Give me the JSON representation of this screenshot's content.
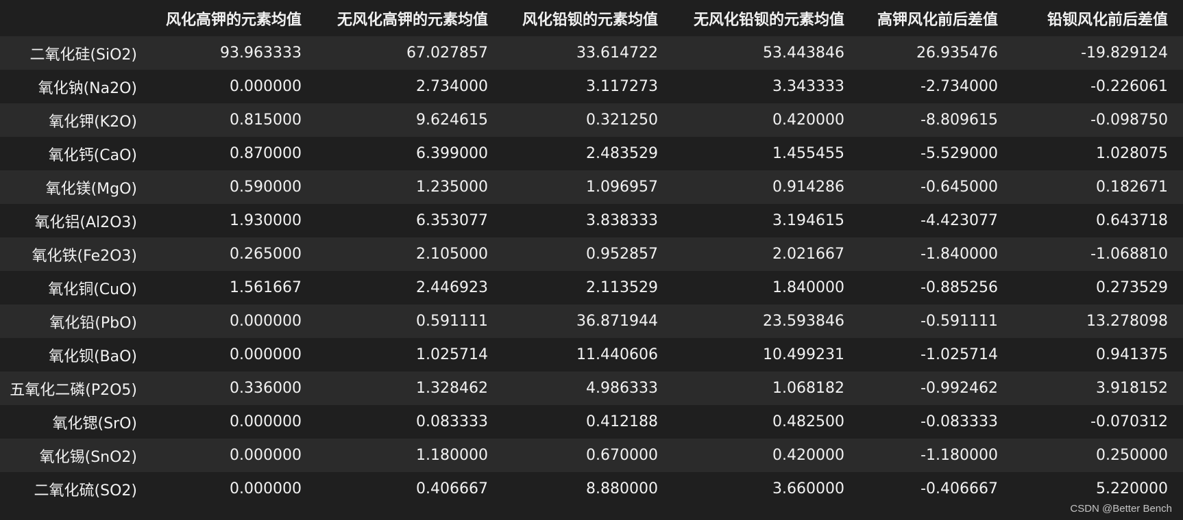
{
  "table": {
    "columns": [
      "",
      "风化高钾的元素均值",
      "无风化高钾的元素均值",
      "风化铅钡的元素均值",
      "无风化铅钡的元素均值",
      "高钾风化前后差值",
      "铅钡风化前后差值"
    ],
    "rows": [
      {
        "name": "二氧化硅(SiO2)",
        "values": [
          "93.963333",
          "67.027857",
          "33.614722",
          "53.443846",
          "26.935476",
          "-19.829124"
        ]
      },
      {
        "name": "氧化钠(Na2O)",
        "values": [
          "0.000000",
          "2.734000",
          "3.117273",
          "3.343333",
          "-2.734000",
          "-0.226061"
        ]
      },
      {
        "name": "氧化钾(K2O)",
        "values": [
          "0.815000",
          "9.624615",
          "0.321250",
          "0.420000",
          "-8.809615",
          "-0.098750"
        ]
      },
      {
        "name": "氧化钙(CaO)",
        "values": [
          "0.870000",
          "6.399000",
          "2.483529",
          "1.455455",
          "-5.529000",
          "1.028075"
        ]
      },
      {
        "name": "氧化镁(MgO)",
        "values": [
          "0.590000",
          "1.235000",
          "1.096957",
          "0.914286",
          "-0.645000",
          "0.182671"
        ]
      },
      {
        "name": "氧化铝(Al2O3)",
        "values": [
          "1.930000",
          "6.353077",
          "3.838333",
          "3.194615",
          "-4.423077",
          "0.643718"
        ]
      },
      {
        "name": "氧化铁(Fe2O3)",
        "values": [
          "0.265000",
          "2.105000",
          "0.952857",
          "2.021667",
          "-1.840000",
          "-1.068810"
        ]
      },
      {
        "name": "氧化铜(CuO)",
        "values": [
          "1.561667",
          "2.446923",
          "2.113529",
          "1.840000",
          "-0.885256",
          "0.273529"
        ]
      },
      {
        "name": "氧化铅(PbO)",
        "values": [
          "0.000000",
          "0.591111",
          "36.871944",
          "23.593846",
          "-0.591111",
          "13.278098"
        ]
      },
      {
        "name": "氧化钡(BaO)",
        "values": [
          "0.000000",
          "1.025714",
          "11.440606",
          "10.499231",
          "-1.025714",
          "0.941375"
        ]
      },
      {
        "name": "五氧化二磷(P2O5)",
        "values": [
          "0.336000",
          "1.328462",
          "4.986333",
          "1.068182",
          "-0.992462",
          "3.918152"
        ]
      },
      {
        "name": "氧化锶(SrO)",
        "values": [
          "0.000000",
          "0.083333",
          "0.412188",
          "0.482500",
          "-0.083333",
          "-0.070312"
        ]
      },
      {
        "name": "氧化锡(SnO2)",
        "values": [
          "0.000000",
          "1.180000",
          "0.670000",
          "0.420000",
          "-1.180000",
          "0.250000"
        ]
      },
      {
        "name": "二氧化硫(SO2)",
        "values": [
          "0.000000",
          "0.406667",
          "8.880000",
          "3.660000",
          "-0.406667",
          "5.220000"
        ]
      }
    ]
  },
  "watermark": "CSDN @Better Bench",
  "colors": {
    "background": "#1f1f1f",
    "row_stripe": "#2b2b2b",
    "text": "#f2f2f2"
  }
}
